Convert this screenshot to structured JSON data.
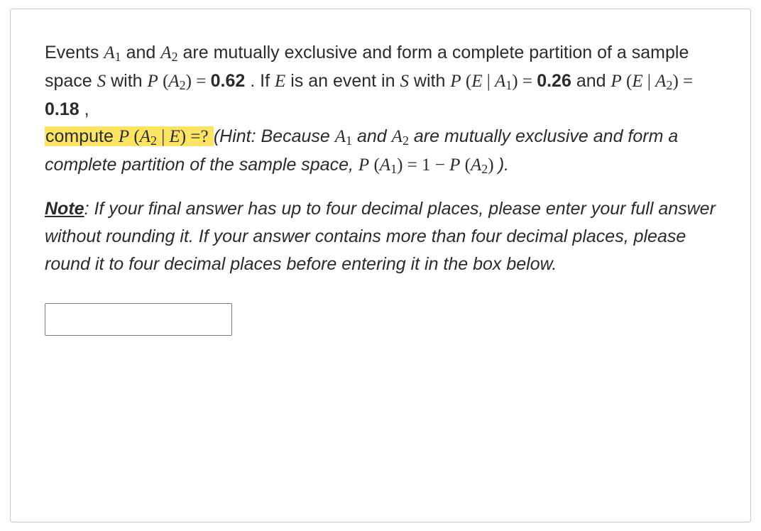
{
  "q": {
    "t1": "Events ",
    "A1": "A",
    "A1s": "1",
    "and": " and ",
    "A2": "A",
    "A2s": "2",
    "t2": " are mutually exclusive and form a complete partition of a sample space ",
    "S": "S",
    "with": "  with ",
    "PA2_lhs_P": "P",
    "open": " (",
    "close": ") ",
    "eq": "= ",
    "PA2_val": "0.62",
    "t3": " .  If ",
    "E": "E",
    "isan": "  is an event in ",
    "with2": "  with ",
    "PEgA1_val": "0.26",
    "and2": "  and   ",
    "PEgA2_val": "0.18",
    "comma": " ,",
    "compute": "compute  ",
    "qmark": "?",
    "hint_open": "  (Hint: Because  ",
    "hint_mid": " are mutually exclusive and form a complete partition of the sample space, ",
    "one_minus": "1 − ",
    "hint_close": " )."
  },
  "note": {
    "label": "Note",
    "text": ": If your final answer has up to four decimal places, please enter your full answer without rounding it. If your answer contains more than four decimal places, please round it to four decimal places before entering it in the box below."
  },
  "answer": {
    "value": "",
    "placeholder": ""
  }
}
